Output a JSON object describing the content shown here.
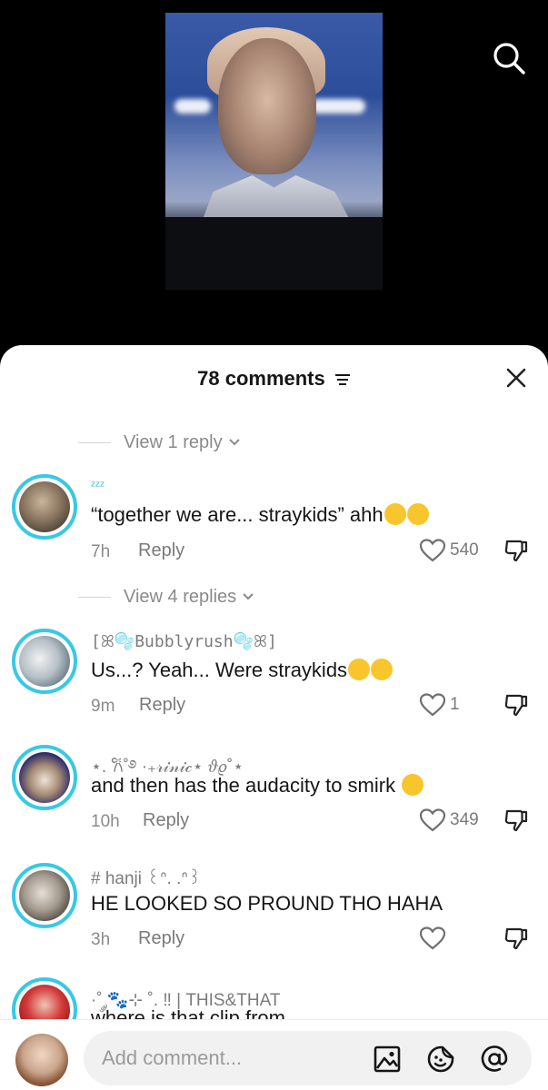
{
  "header": {
    "comment_count": "78 comments"
  },
  "threads": [
    {
      "view_replies": "View 1 reply",
      "username": "ᶻᶻᶻ",
      "text": "“together we are... straykids” ahh",
      "text_emojis": [
        "loudly-crying-face",
        "loudly-crying-face"
      ],
      "time": "7h",
      "reply_label": "Reply",
      "likes": "540"
    },
    {
      "view_replies": "View 4 replies",
      "username": "[ꕤ🫧Bubblyrush🫧ꕤ]",
      "text": "Us...? Yeah... Were straykids",
      "text_emojis": [
        "shushing-face",
        "smirking-face"
      ],
      "time": "9m",
      "reply_label": "Reply",
      "likes": "1"
    },
    {
      "username": "⋆. 𐙚˚࿔ ·₊𝓇𝒾𝓃𝒾𝒸⋆ 𝜗𝜚˚⋆",
      "text": "and then has the audacity to smirk",
      "text_emojis": [
        "loudly-crying-face"
      ],
      "time": "10h",
      "reply_label": "Reply",
      "likes": "349"
    },
    {
      "username": "# hanji ꒰ᐢ. .ᐢ꒱",
      "text": "HE LOOKED SO PROUND THO HAHA",
      "text_emojis": [],
      "time": "3h",
      "reply_label": "Reply",
      "likes": ""
    },
    {
      "username": "·˚ ༘🐾⊹ ˚. ‼ | THIS&THAT",
      "text": "where is that clip from"
    }
  ],
  "composer": {
    "placeholder": "Add comment..."
  },
  "colors": {
    "avatar_ring": "#37c9e4",
    "emoji_yellow": "#f9c52c"
  }
}
